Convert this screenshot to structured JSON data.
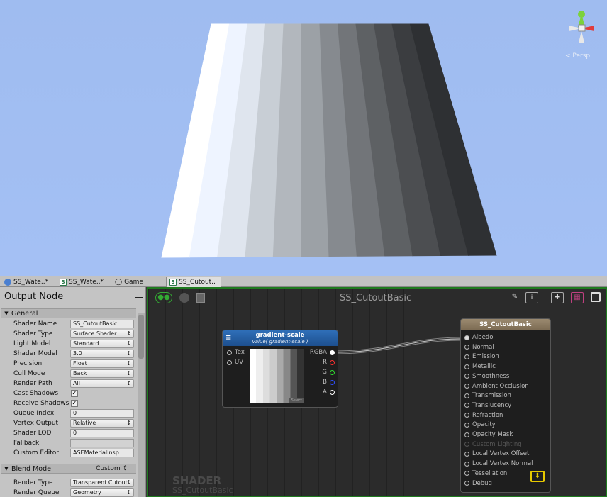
{
  "scene": {
    "stripe_colors": [
      "#ffffff",
      "#eef4ff",
      "#dfe5ee",
      "#c8ced5",
      "#b2b7bd",
      "#9ca1a6",
      "#868a8f",
      "#727579",
      "#5e6164",
      "#4c4e51",
      "#3b3d40",
      "#2e3033"
    ],
    "persp_label": "< Persp"
  },
  "tabs": [
    {
      "label": "SS_Wate..*",
      "icon": "globe-icon"
    },
    {
      "label": "SS_Wate..*",
      "icon": "shader-s-icon"
    },
    {
      "label": "Game",
      "icon": "game-icon"
    },
    {
      "label": "SS_Cutout..",
      "icon": "shader-s-icon"
    }
  ],
  "inspector": {
    "title": "Output Node",
    "general_section": "General",
    "rows": [
      {
        "label": "Shader Name",
        "value": "SS_CutoutBasic",
        "kind": "text"
      },
      {
        "label": "Shader Type",
        "value": "Surface Shader",
        "kind": "dropdown"
      },
      {
        "label": "Light Model",
        "value": "Standard",
        "kind": "dropdown"
      },
      {
        "label": "Shader Model",
        "value": "3.0",
        "kind": "dropdown"
      },
      {
        "label": "Precision",
        "value": "Float",
        "kind": "dropdown"
      },
      {
        "label": "Cull Mode",
        "value": "Back",
        "kind": "dropdown"
      },
      {
        "label": "Render Path",
        "value": "All",
        "kind": "dropdown"
      },
      {
        "label": "Cast Shadows",
        "value": "✓",
        "kind": "check"
      },
      {
        "label": "Receive Shadows",
        "value": "✓",
        "kind": "check"
      },
      {
        "label": "Queue Index",
        "value": "0",
        "kind": "text"
      },
      {
        "label": "Vertex Output",
        "value": "Relative",
        "kind": "dropdown"
      },
      {
        "label": "Shader LOD",
        "value": "0",
        "kind": "text"
      },
      {
        "label": "Fallback",
        "value": "",
        "kind": "disabled"
      },
      {
        "label": "Custom Editor",
        "value": "ASEMaterialInsp",
        "kind": "text"
      }
    ],
    "blend_section": "Blend Mode",
    "blend_value": "Custom",
    "blend_rows": [
      {
        "label": "Render Type",
        "value": "Transparent Cutout",
        "kind": "dropdown"
      },
      {
        "label": "Render Queue",
        "value": "Geometry",
        "kind": "dropdown"
      }
    ]
  },
  "canvas": {
    "title": "SS_CutoutBasic",
    "watermark_line1": "SHADER",
    "watermark_line2": "SS_CutoutBasic",
    "node_gradient": {
      "title": "gradient-scale",
      "subtitle": "Value( gradient-scale )",
      "inputs": [
        "Tex",
        "UV"
      ],
      "outputs": [
        {
          "label": "RGBA",
          "color": "#ffffff"
        },
        {
          "label": "R",
          "color": "#ff3030"
        },
        {
          "label": "G",
          "color": "#30e030"
        },
        {
          "label": "B",
          "color": "#3050ff"
        },
        {
          "label": "A",
          "color": "#ffffff"
        }
      ],
      "select_label": "Select"
    },
    "node_output": {
      "title": "SS_CutoutBasic",
      "ports": [
        {
          "label": "Albedo",
          "disabled": false
        },
        {
          "label": "Normal",
          "disabled": false
        },
        {
          "label": "Emission",
          "disabled": false
        },
        {
          "label": "Metallic",
          "disabled": false
        },
        {
          "label": "Smoothness",
          "disabled": false
        },
        {
          "label": "Ambient Occlusion",
          "disabled": false
        },
        {
          "label": "Transmission",
          "disabled": false
        },
        {
          "label": "Translucency",
          "disabled": false
        },
        {
          "label": "Refraction",
          "disabled": false
        },
        {
          "label": "Opacity",
          "disabled": false
        },
        {
          "label": "Opacity Mask",
          "disabled": false
        },
        {
          "label": "Custom Lighting",
          "disabled": true
        },
        {
          "label": "Local Vertex Offset",
          "disabled": false
        },
        {
          "label": "Local Vertex Normal",
          "disabled": false
        },
        {
          "label": "Tessellation",
          "disabled": false
        },
        {
          "label": "Debug",
          "disabled": false
        }
      ]
    }
  }
}
